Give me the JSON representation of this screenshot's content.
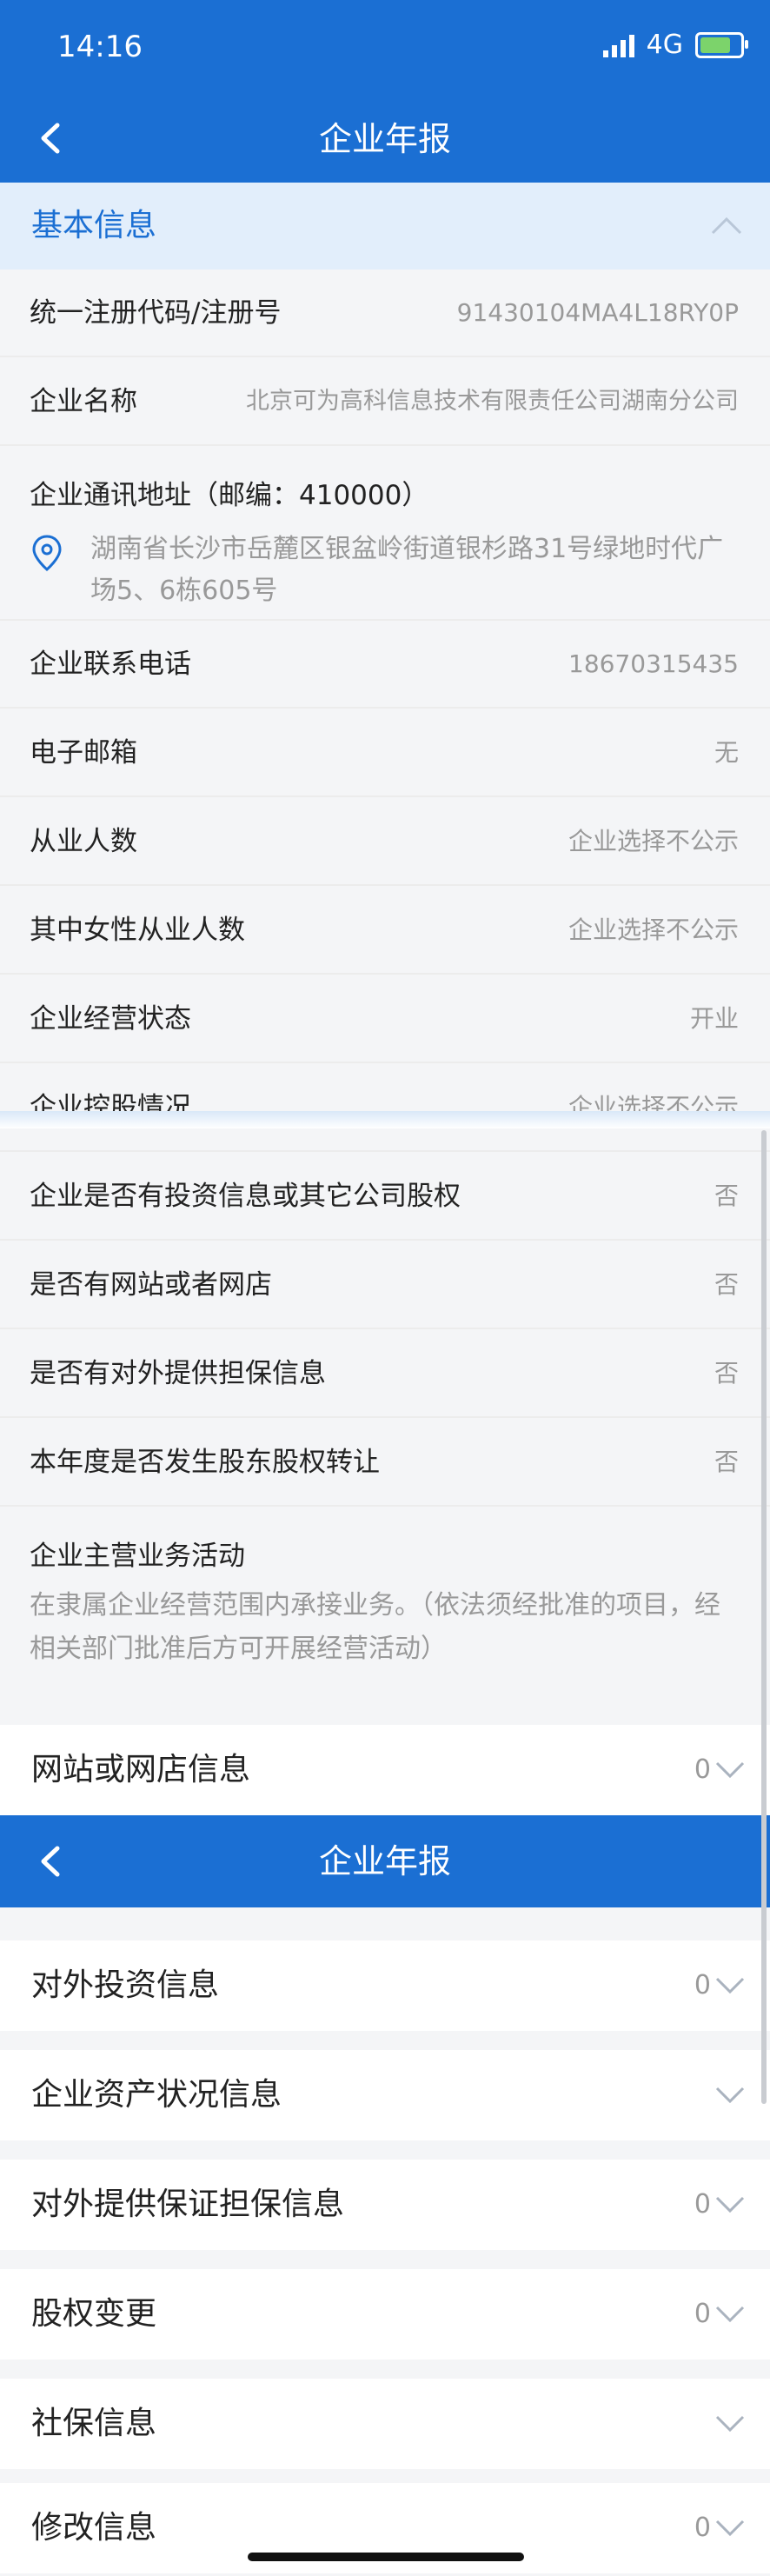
{
  "status_bar": {
    "time": "14:16",
    "network": "4G"
  },
  "navbar": {
    "title": "企业年报"
  },
  "basic_info": {
    "title": "基本信息",
    "rows": [
      {
        "label": "统一注册代码/注册号",
        "value": "91430104MA4L18RY0P"
      },
      {
        "label": "企业名称",
        "value": "北京可为高科信息技术有限责任公司湖南分公司"
      }
    ],
    "address": {
      "label": "企业通讯地址（邮编：410000）",
      "text": "湖南省长沙市岳麓区银盆岭街道银杉路31号绿地时代广场5、6栋605号"
    },
    "rows2": [
      {
        "label": "企业联系电话",
        "value": "18670315435"
      },
      {
        "label": "电子邮箱",
        "value": "无"
      },
      {
        "label": "从业人数",
        "value": "企业选择不公示"
      },
      {
        "label": "其中女性从业人数",
        "value": "企业选择不公示"
      },
      {
        "label": "企业经营状态",
        "value": "开业"
      },
      {
        "label": "企业控股情况",
        "value": "企业选择不公示"
      },
      {
        "label": "企业是否有投资信息或其它公司股权",
        "value": "否"
      },
      {
        "label": "是否有网站或者网店",
        "value": "否"
      },
      {
        "label": "是否有对外提供担保信息",
        "value": "否"
      },
      {
        "label": "本年度是否发生股东股权转让",
        "value": "否"
      }
    ],
    "activity": {
      "label": "企业主营业务活动",
      "text": "在隶属企业经营范围内承接业务。（依法须经批准的项目，经相关部门批准后方可开展经营活动）"
    }
  },
  "sections": [
    {
      "label": "网站或网店信息",
      "count": "0"
    },
    {
      "label": "对外投资信息",
      "count": "0"
    },
    {
      "label": "企业资产状况信息",
      "count": ""
    },
    {
      "label": "对外提供保证担保信息",
      "count": "0"
    },
    {
      "label": "股权变更",
      "count": "0"
    },
    {
      "label": "社保信息",
      "count": ""
    },
    {
      "label": "修改信息",
      "count": "0"
    }
  ],
  "colors": {
    "primary": "#1b6fd3",
    "header_bg": "#e2eefb",
    "muted_text": "#999999"
  }
}
